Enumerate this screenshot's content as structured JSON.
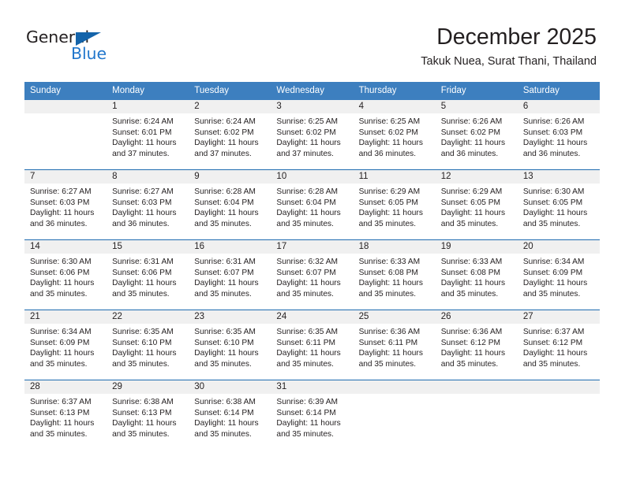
{
  "brand": {
    "name_part1": "General",
    "name_part2": "Blue",
    "triangle_color": "#1464aa",
    "blue_color": "#2277cc"
  },
  "header": {
    "title": "December 2025",
    "subtitle": "Takuk Nuea, Surat Thani, Thailand"
  },
  "theme": {
    "header_row_bg": "#3d7fbf",
    "row_divider": "#1f6cb0",
    "daynum_bg": "#f0f0f0",
    "text": "#231f20"
  },
  "weekday_headers": [
    "Sunday",
    "Monday",
    "Tuesday",
    "Wednesday",
    "Thursday",
    "Friday",
    "Saturday"
  ],
  "weeks": [
    [
      {
        "empty": true
      },
      {
        "day": "1",
        "sunrise": "Sunrise: 6:24 AM",
        "sunset": "Sunset: 6:01 PM",
        "daylight_line1": "Daylight: 11 hours",
        "daylight_line2": "and 37 minutes."
      },
      {
        "day": "2",
        "sunrise": "Sunrise: 6:24 AM",
        "sunset": "Sunset: 6:02 PM",
        "daylight_line1": "Daylight: 11 hours",
        "daylight_line2": "and 37 minutes."
      },
      {
        "day": "3",
        "sunrise": "Sunrise: 6:25 AM",
        "sunset": "Sunset: 6:02 PM",
        "daylight_line1": "Daylight: 11 hours",
        "daylight_line2": "and 37 minutes."
      },
      {
        "day": "4",
        "sunrise": "Sunrise: 6:25 AM",
        "sunset": "Sunset: 6:02 PM",
        "daylight_line1": "Daylight: 11 hours",
        "daylight_line2": "and 36 minutes."
      },
      {
        "day": "5",
        "sunrise": "Sunrise: 6:26 AM",
        "sunset": "Sunset: 6:02 PM",
        "daylight_line1": "Daylight: 11 hours",
        "daylight_line2": "and 36 minutes."
      },
      {
        "day": "6",
        "sunrise": "Sunrise: 6:26 AM",
        "sunset": "Sunset: 6:03 PM",
        "daylight_line1": "Daylight: 11 hours",
        "daylight_line2": "and 36 minutes."
      }
    ],
    [
      {
        "day": "7",
        "sunrise": "Sunrise: 6:27 AM",
        "sunset": "Sunset: 6:03 PM",
        "daylight_line1": "Daylight: 11 hours",
        "daylight_line2": "and 36 minutes."
      },
      {
        "day": "8",
        "sunrise": "Sunrise: 6:27 AM",
        "sunset": "Sunset: 6:03 PM",
        "daylight_line1": "Daylight: 11 hours",
        "daylight_line2": "and 36 minutes."
      },
      {
        "day": "9",
        "sunrise": "Sunrise: 6:28 AM",
        "sunset": "Sunset: 6:04 PM",
        "daylight_line1": "Daylight: 11 hours",
        "daylight_line2": "and 35 minutes."
      },
      {
        "day": "10",
        "sunrise": "Sunrise: 6:28 AM",
        "sunset": "Sunset: 6:04 PM",
        "daylight_line1": "Daylight: 11 hours",
        "daylight_line2": "and 35 minutes."
      },
      {
        "day": "11",
        "sunrise": "Sunrise: 6:29 AM",
        "sunset": "Sunset: 6:05 PM",
        "daylight_line1": "Daylight: 11 hours",
        "daylight_line2": "and 35 minutes."
      },
      {
        "day": "12",
        "sunrise": "Sunrise: 6:29 AM",
        "sunset": "Sunset: 6:05 PM",
        "daylight_line1": "Daylight: 11 hours",
        "daylight_line2": "and 35 minutes."
      },
      {
        "day": "13",
        "sunrise": "Sunrise: 6:30 AM",
        "sunset": "Sunset: 6:05 PM",
        "daylight_line1": "Daylight: 11 hours",
        "daylight_line2": "and 35 minutes."
      }
    ],
    [
      {
        "day": "14",
        "sunrise": "Sunrise: 6:30 AM",
        "sunset": "Sunset: 6:06 PM",
        "daylight_line1": "Daylight: 11 hours",
        "daylight_line2": "and 35 minutes."
      },
      {
        "day": "15",
        "sunrise": "Sunrise: 6:31 AM",
        "sunset": "Sunset: 6:06 PM",
        "daylight_line1": "Daylight: 11 hours",
        "daylight_line2": "and 35 minutes."
      },
      {
        "day": "16",
        "sunrise": "Sunrise: 6:31 AM",
        "sunset": "Sunset: 6:07 PM",
        "daylight_line1": "Daylight: 11 hours",
        "daylight_line2": "and 35 minutes."
      },
      {
        "day": "17",
        "sunrise": "Sunrise: 6:32 AM",
        "sunset": "Sunset: 6:07 PM",
        "daylight_line1": "Daylight: 11 hours",
        "daylight_line2": "and 35 minutes."
      },
      {
        "day": "18",
        "sunrise": "Sunrise: 6:33 AM",
        "sunset": "Sunset: 6:08 PM",
        "daylight_line1": "Daylight: 11 hours",
        "daylight_line2": "and 35 minutes."
      },
      {
        "day": "19",
        "sunrise": "Sunrise: 6:33 AM",
        "sunset": "Sunset: 6:08 PM",
        "daylight_line1": "Daylight: 11 hours",
        "daylight_line2": "and 35 minutes."
      },
      {
        "day": "20",
        "sunrise": "Sunrise: 6:34 AM",
        "sunset": "Sunset: 6:09 PM",
        "daylight_line1": "Daylight: 11 hours",
        "daylight_line2": "and 35 minutes."
      }
    ],
    [
      {
        "day": "21",
        "sunrise": "Sunrise: 6:34 AM",
        "sunset": "Sunset: 6:09 PM",
        "daylight_line1": "Daylight: 11 hours",
        "daylight_line2": "and 35 minutes."
      },
      {
        "day": "22",
        "sunrise": "Sunrise: 6:35 AM",
        "sunset": "Sunset: 6:10 PM",
        "daylight_line1": "Daylight: 11 hours",
        "daylight_line2": "and 35 minutes."
      },
      {
        "day": "23",
        "sunrise": "Sunrise: 6:35 AM",
        "sunset": "Sunset: 6:10 PM",
        "daylight_line1": "Daylight: 11 hours",
        "daylight_line2": "and 35 minutes."
      },
      {
        "day": "24",
        "sunrise": "Sunrise: 6:35 AM",
        "sunset": "Sunset: 6:11 PM",
        "daylight_line1": "Daylight: 11 hours",
        "daylight_line2": "and 35 minutes."
      },
      {
        "day": "25",
        "sunrise": "Sunrise: 6:36 AM",
        "sunset": "Sunset: 6:11 PM",
        "daylight_line1": "Daylight: 11 hours",
        "daylight_line2": "and 35 minutes."
      },
      {
        "day": "26",
        "sunrise": "Sunrise: 6:36 AM",
        "sunset": "Sunset: 6:12 PM",
        "daylight_line1": "Daylight: 11 hours",
        "daylight_line2": "and 35 minutes."
      },
      {
        "day": "27",
        "sunrise": "Sunrise: 6:37 AM",
        "sunset": "Sunset: 6:12 PM",
        "daylight_line1": "Daylight: 11 hours",
        "daylight_line2": "and 35 minutes."
      }
    ],
    [
      {
        "day": "28",
        "sunrise": "Sunrise: 6:37 AM",
        "sunset": "Sunset: 6:13 PM",
        "daylight_line1": "Daylight: 11 hours",
        "daylight_line2": "and 35 minutes."
      },
      {
        "day": "29",
        "sunrise": "Sunrise: 6:38 AM",
        "sunset": "Sunset: 6:13 PM",
        "daylight_line1": "Daylight: 11 hours",
        "daylight_line2": "and 35 minutes."
      },
      {
        "day": "30",
        "sunrise": "Sunrise: 6:38 AM",
        "sunset": "Sunset: 6:14 PM",
        "daylight_line1": "Daylight: 11 hours",
        "daylight_line2": "and 35 minutes."
      },
      {
        "day": "31",
        "sunrise": "Sunrise: 6:39 AM",
        "sunset": "Sunset: 6:14 PM",
        "daylight_line1": "Daylight: 11 hours",
        "daylight_line2": "and 35 minutes."
      },
      {
        "empty": true
      },
      {
        "empty": true
      },
      {
        "empty": true
      }
    ]
  ]
}
